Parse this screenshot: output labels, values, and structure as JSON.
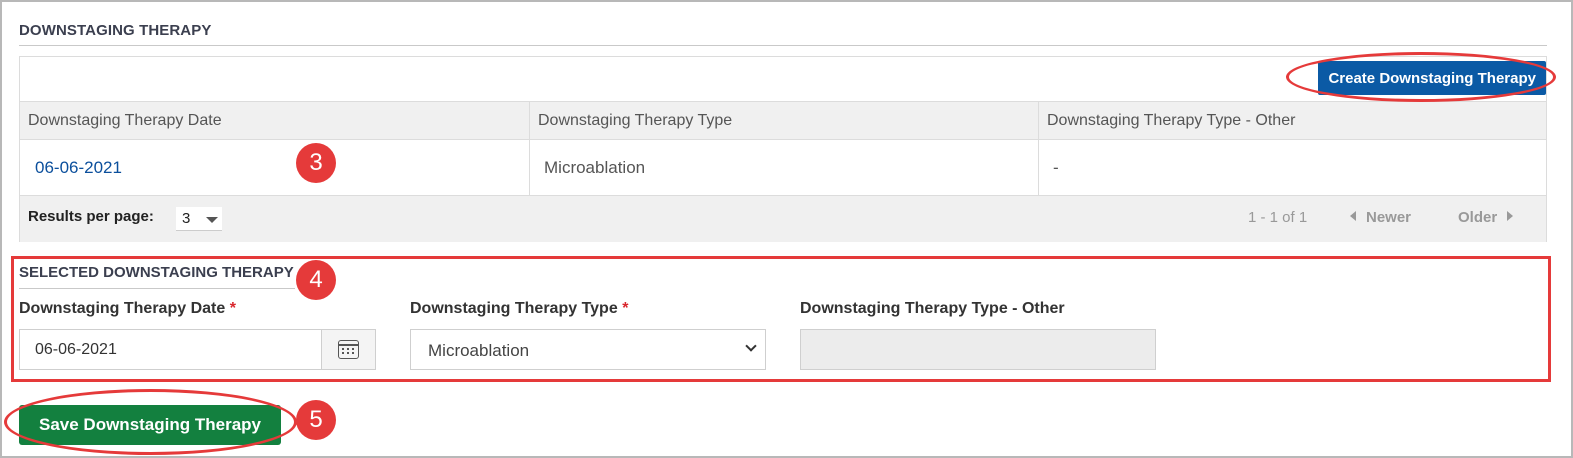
{
  "section": {
    "title": "DOWNSTAGING THERAPY"
  },
  "toolbar": {
    "create_label": "Create Downstaging Therapy"
  },
  "table": {
    "columns": [
      "Downstaging Therapy Date",
      "Downstaging Therapy Type",
      "Downstaging Therapy Type - Other"
    ],
    "rows": [
      [
        "06-06-2021",
        "Microablation",
        "-"
      ]
    ]
  },
  "pager": {
    "results_label": "Results per page:",
    "results_value": "3",
    "info": "1 - 1 of 1",
    "newer": "Newer",
    "older": "Older"
  },
  "selected": {
    "title": "SELECTED DOWNSTAGING THERAPY",
    "date_label": "Downstaging Therapy Date",
    "date_value": "06-06-2021",
    "type_label": "Downstaging Therapy Type",
    "type_value": "Microablation",
    "other_label": "Downstaging Therapy Type - Other",
    "other_value": "",
    "required_mark": "*"
  },
  "actions": {
    "save_label": "Save Downstaging Therapy"
  },
  "annotations": {
    "badge_3": "3",
    "badge_4": "4",
    "badge_5": "5"
  },
  "colors": {
    "create_button": "#0b5aa5",
    "save_button": "#13803f",
    "annotation_red": "#e53a3a",
    "link": "#0b4f9c"
  }
}
